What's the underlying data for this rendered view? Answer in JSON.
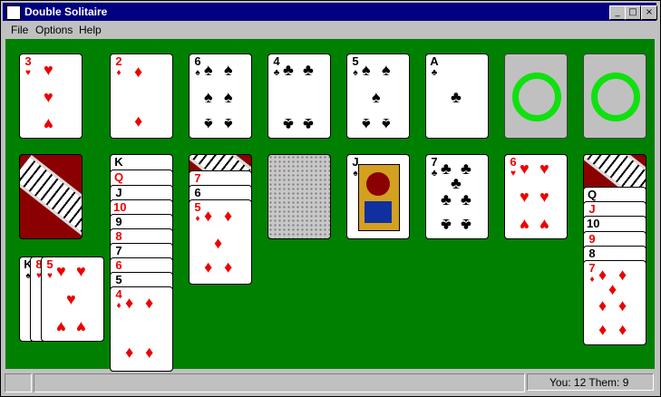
{
  "window": {
    "title": "Double Solitaire",
    "minimize": "_",
    "maximize": "□",
    "close": "×"
  },
  "menu": [
    "File",
    "Options",
    "Help"
  ],
  "status": {
    "score": "You: 12  Them: 9"
  },
  "colors": {
    "felt": "#008000",
    "titlebar": "#000080",
    "red_suit": "#e00000",
    "ring": "#10e010",
    "card_back": "#8b0000"
  },
  "foundations": [
    {
      "rank": "3",
      "suit": "♥",
      "color": "red"
    },
    {
      "rank": "2",
      "suit": "♦",
      "color": "red"
    },
    {
      "rank": "6",
      "suit": "♠",
      "color": "black"
    },
    {
      "rank": "4",
      "suit": "♣",
      "color": "black"
    },
    {
      "rank": "5",
      "suit": "♠",
      "color": "black"
    },
    {
      "rank": "A",
      "suit": "♣",
      "color": "black"
    },
    {
      "rank": "",
      "suit": "",
      "color": "empty"
    },
    {
      "rank": "",
      "suit": "",
      "color": "empty"
    }
  ],
  "tableau": {
    "col2": [
      {
        "rank": "K",
        "suit": "♣"
      },
      {
        "rank": "Q",
        "suit": "♦"
      },
      {
        "rank": "J",
        "suit": "♠"
      },
      {
        "rank": "10",
        "suit": "♦"
      },
      {
        "rank": "9",
        "suit": "♠"
      },
      {
        "rank": "8",
        "suit": "♦"
      },
      {
        "rank": "7",
        "suit": "♠"
      },
      {
        "rank": "6",
        "suit": "♦"
      },
      {
        "rank": "5",
        "suit": "♠"
      },
      {
        "rank": "4",
        "suit": "♦"
      }
    ],
    "col3": [
      {
        "rank": "7",
        "suit": "♥"
      },
      {
        "rank": "6",
        "suit": "♠"
      },
      {
        "rank": "5",
        "suit": "♦"
      }
    ],
    "col5": {
      "rank": "J",
      "suit": "♠"
    },
    "col6": {
      "rank": "7",
      "suit": "♣"
    },
    "col7": {
      "rank": "6",
      "suit": "♥"
    },
    "col8": [
      {
        "rank": "Q",
        "suit": "♠"
      },
      {
        "rank": "J",
        "suit": "♦"
      },
      {
        "rank": "10",
        "suit": "♠"
      },
      {
        "rank": "9",
        "suit": "♥"
      },
      {
        "rank": "8",
        "suit": "♠"
      },
      {
        "rank": "7",
        "suit": "♦"
      }
    ]
  },
  "hand": [
    {
      "rank": "K",
      "suit": "♠"
    },
    {
      "rank": "8",
      "suit": "♥"
    },
    {
      "rank": "5",
      "suit": "♥"
    }
  ]
}
